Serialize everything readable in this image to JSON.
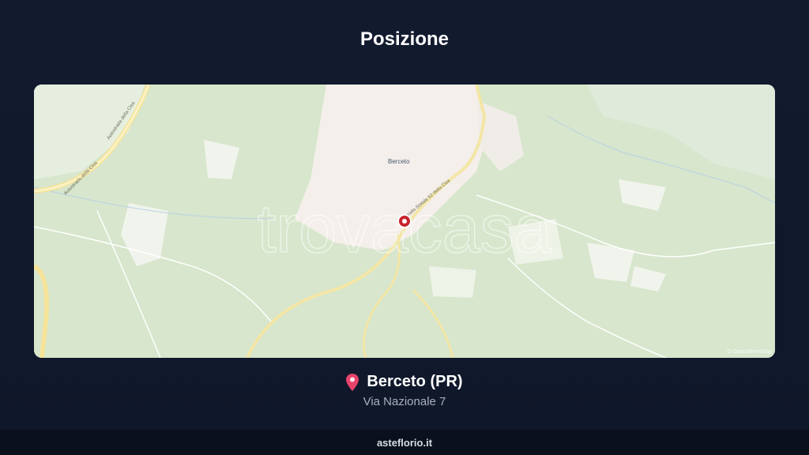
{
  "page": {
    "title": "Posizione"
  },
  "map": {
    "town_label": "Berceto",
    "road_labels": [
      "Autostrada della Cisa",
      "Autostrada della Cisa",
      "Strada Statale 62 della Cisa"
    ],
    "watermark": "trovacasa",
    "attribution": "© OpenStreetMap",
    "marker_icon": "map-marker-icon"
  },
  "location": {
    "pin_icon": "pin-icon",
    "name": "Berceto (PR)",
    "address": "Via Nazionale 7"
  },
  "footer": {
    "site": "asteflorio.it"
  },
  "colors": {
    "background": "#0f172a",
    "map_forest": "#d6e6cb",
    "map_urban": "#f6f2ee",
    "road": "#f5e9a8",
    "marker": "#c8232c",
    "pin": "#e8436b"
  }
}
